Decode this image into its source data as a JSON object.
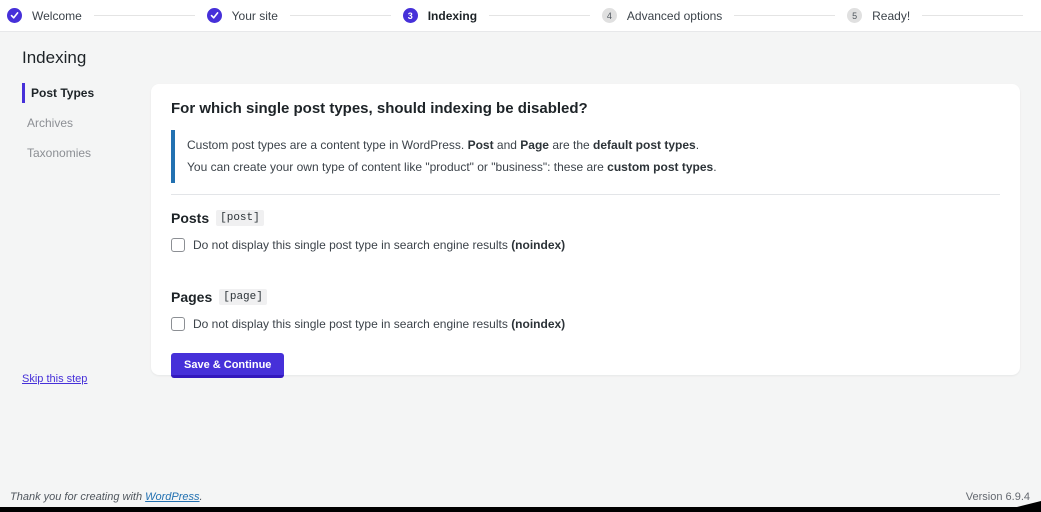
{
  "colors": {
    "accent": "#4630d9",
    "notice_border": "#2271b1",
    "link_blue": "#2271b1"
  },
  "stepper": {
    "steps": [
      {
        "label": "Welcome",
        "state": "done"
      },
      {
        "label": "Your site",
        "state": "done"
      },
      {
        "label": "Indexing",
        "number": "3",
        "state": "current"
      },
      {
        "label": "Advanced options",
        "number": "4",
        "state": "upcoming"
      },
      {
        "label": "Ready!",
        "number": "5",
        "state": "upcoming"
      }
    ]
  },
  "page": {
    "title": "Indexing"
  },
  "sidebar": {
    "items": [
      {
        "label": "Post Types",
        "active": true
      },
      {
        "label": "Archives",
        "active": false
      },
      {
        "label": "Taxonomies",
        "active": false
      }
    ]
  },
  "main": {
    "question": "For which single post types, should indexing be disabled?",
    "notice_lines": [
      [
        {
          "t": "Custom post types are a content type in WordPress. "
        },
        {
          "t": "Post",
          "b": true
        },
        {
          "t": " and "
        },
        {
          "t": "Page",
          "b": true
        },
        {
          "t": " are the "
        },
        {
          "t": "default post types",
          "b": true
        },
        {
          "t": "."
        }
      ],
      [
        {
          "t": "You can create your own type of content like \"product\" or \"business\": these are "
        },
        {
          "t": "custom post types",
          "b": true
        },
        {
          "t": "."
        }
      ]
    ],
    "post_types": [
      {
        "name": "Posts",
        "slug": "[post]",
        "checkbox_label": [
          {
            "t": "Do not display this single post type in search engine results "
          },
          {
            "t": "(noindex)",
            "b": true
          }
        ],
        "checked": false
      },
      {
        "name": "Pages",
        "slug": "[page]",
        "checkbox_label": [
          {
            "t": "Do not display this single post type in search engine results "
          },
          {
            "t": "(noindex)",
            "b": true
          }
        ],
        "checked": false
      }
    ],
    "save_button": "Save & Continue"
  },
  "skip_link": "Skip this step",
  "footer": {
    "thanks_prefix": "Thank you for creating with ",
    "thanks_link": "WordPress",
    "thanks_suffix": ".",
    "version": "Version 6.9.4"
  }
}
